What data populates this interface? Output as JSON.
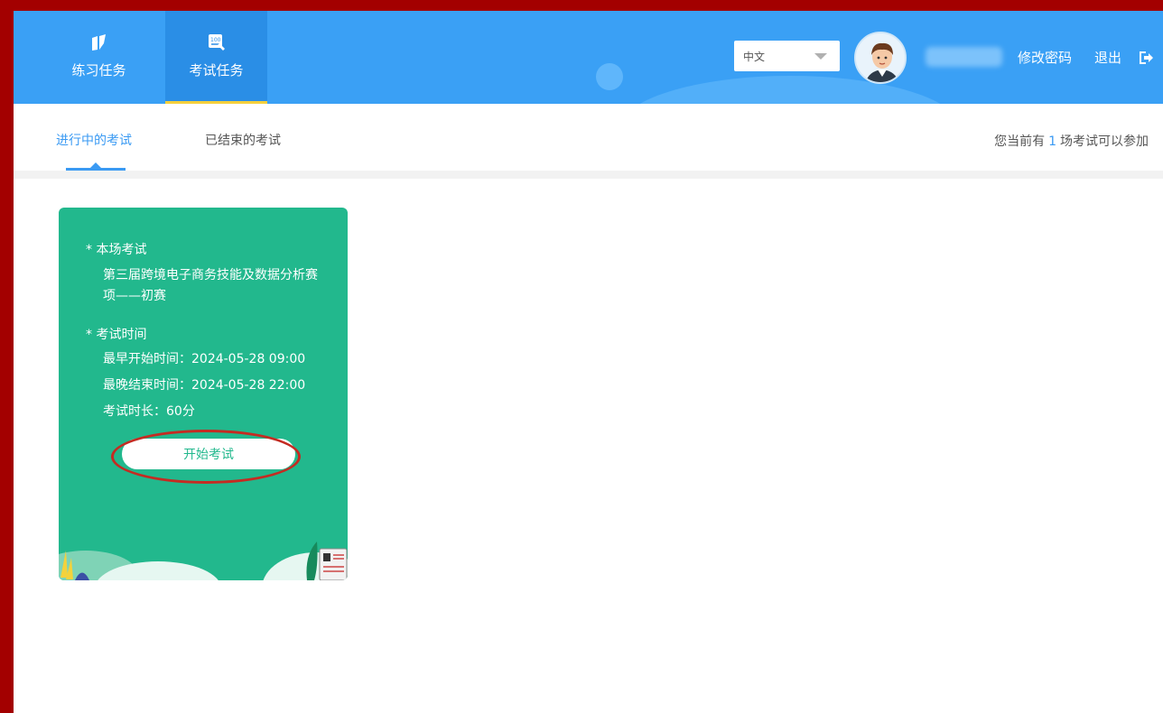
{
  "header": {
    "nav": [
      {
        "label": "练习任务",
        "icon": "practice-icon"
      },
      {
        "label": "考试任务",
        "icon": "exam-icon"
      }
    ],
    "language": "中文",
    "change_password": "修改密码",
    "logout": "退出"
  },
  "subtabs": {
    "active": "进行中的考试",
    "ended": "已结束的考试",
    "count_prefix": "您当前有",
    "count": "1",
    "count_suffix": "场考试可以参加"
  },
  "card": {
    "section1_title": "* 本场考试",
    "exam_name": "第三届跨境电子商务技能及数据分析赛项——初赛",
    "section2_title": "* 考试时间",
    "earliest_start": "最早开始时间：2024-05-28 09:00",
    "latest_end": "最晚结束时间：2024-05-28 22:00",
    "duration": "考试时长：60分",
    "start_button": "开始考试"
  },
  "colors": {
    "header": "#3aa0f5",
    "accent": "#3a9af3",
    "card": "#22b88d",
    "highlight": "#c52b22"
  }
}
